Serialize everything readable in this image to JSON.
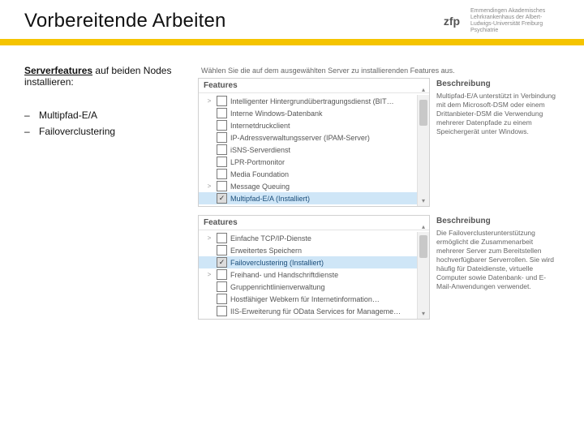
{
  "header": {
    "title": "Vorbereitende Arbeiten",
    "logo_mark": "zfp",
    "logo_text": "Emmendingen\nAkademisches Lehrkrankenhaus der\nAlbert-Ludwigs-Universität Freiburg\nPsychiatrie"
  },
  "intro_strong": "Serverfeatures",
  "intro_rest": " auf beiden Nodes installieren:",
  "bullets": [
    "Multipfad-E/A",
    "Failoverclustering"
  ],
  "panel1": {
    "instruction": "Wählen Sie die auf dem ausgewählten Server zu installierenden Features aus.",
    "tree_header": "Features",
    "items": [
      {
        "expand": ">",
        "checked": false,
        "label": "Intelligenter Hintergrundübertragungsdienst (BIT…"
      },
      {
        "expand": "",
        "checked": false,
        "label": "Interne Windows-Datenbank"
      },
      {
        "expand": "",
        "checked": false,
        "label": "Internetdruckclient"
      },
      {
        "expand": "",
        "checked": false,
        "label": "IP-Adressverwaltungsserver (IPAM-Server)"
      },
      {
        "expand": "",
        "checked": false,
        "label": "iSNS-Serverdienst"
      },
      {
        "expand": "",
        "checked": false,
        "label": "LPR-Portmonitor"
      },
      {
        "expand": "",
        "checked": false,
        "label": "Media Foundation"
      },
      {
        "expand": ">",
        "checked": false,
        "label": "Message Queuing"
      },
      {
        "expand": "",
        "checked": true,
        "grey": true,
        "selected": true,
        "label": "Multipfad-E/A (Installiert)"
      }
    ],
    "desc_header": "Beschreibung",
    "desc_text": "Multipfad-E/A unterstützt in Verbindung mit dem Microsoft-DSM oder einem Drittanbieter-DSM die Verwendung mehrerer Datenpfade zu einem Speichergerät unter Windows."
  },
  "panel2": {
    "tree_header": "Features",
    "items": [
      {
        "expand": ">",
        "checked": false,
        "label": "Einfache TCP/IP-Dienste"
      },
      {
        "expand": "",
        "checked": false,
        "label": "Erweitertes Speichern"
      },
      {
        "expand": "",
        "checked": true,
        "grey": true,
        "selected": true,
        "label": "Failoverclustering (Installiert)"
      },
      {
        "expand": ">",
        "checked": false,
        "label": "Freihand- und Handschriftdienste"
      },
      {
        "expand": "",
        "checked": false,
        "label": "Gruppenrichtlinienverwaltung"
      },
      {
        "expand": "",
        "checked": false,
        "label": "Hostfähiger Webkern für Internetinformation…"
      },
      {
        "expand": "",
        "checked": false,
        "label": "IIS-Erweiterung für OData Services for Manageme…"
      }
    ],
    "desc_header": "Beschreibung",
    "desc_text": "Die Failoverclusterunterstützung ermöglicht die Zusammenarbeit mehrerer Server zum Bereitstellen hochverfügbarer Serverrollen. Sie wird häufig für Dateidienste, virtuelle Computer sowie Datenbank- und E-Mail-Anwendungen verwendet."
  }
}
